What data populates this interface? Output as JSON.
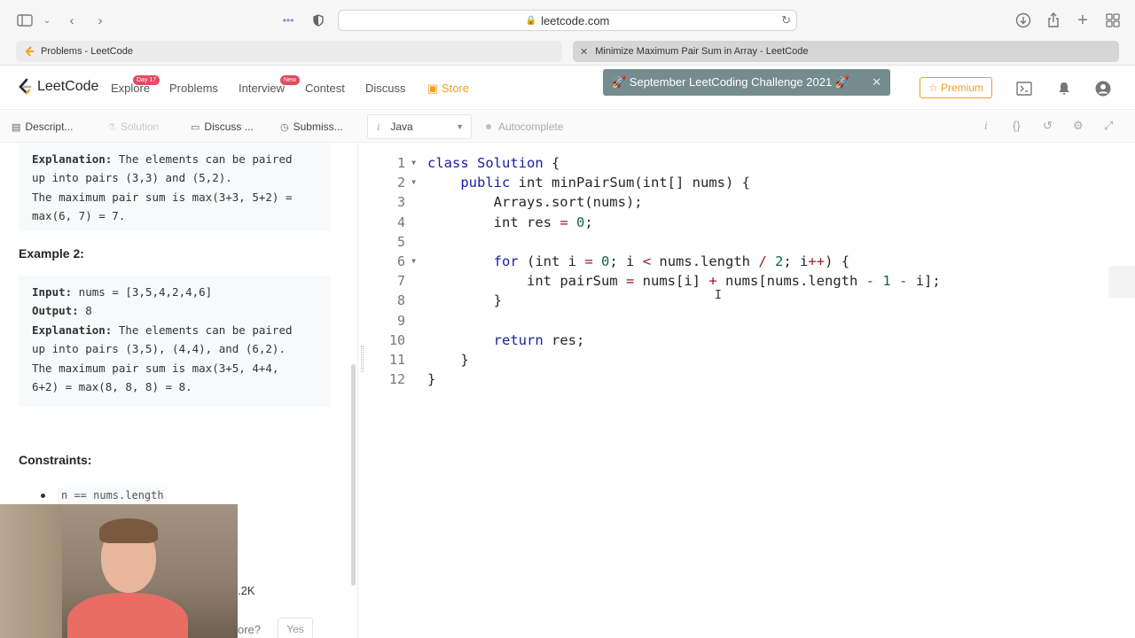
{
  "browser": {
    "url": "leetcode.com",
    "tabs": [
      {
        "title": "Problems - LeetCode"
      },
      {
        "title": "Minimize Maximum Pair Sum in Array - LeetCode"
      }
    ]
  },
  "nav": {
    "logo": "LeetCode",
    "items": [
      "Explore",
      "Problems",
      "Interview",
      "Contest",
      "Discuss",
      "Store"
    ],
    "explore_badge": "Day 17",
    "interview_badge": "New",
    "challenge": "🚀 September LeetCoding Challenge 2021 🚀",
    "premium": "☆ Premium"
  },
  "subtabs": {
    "description": "Descript...",
    "solution": "Solution",
    "discuss": "Discuss ...",
    "submissions": "Submiss..."
  },
  "editor_toolbar": {
    "language": "Java",
    "autocomplete": "Autocomplete"
  },
  "description": {
    "example1_explanation": [
      "Explanation: The elements can be paired",
      "up into pairs (3,3) and (5,2).",
      "The maximum pair sum is max(3+3, 5+2) =",
      "max(6, 7) = 7."
    ],
    "example2_title": "Example 2:",
    "example2_lines": [
      "Input: nums = [3,5,4,2,4,6]",
      "Output: 8",
      "Explanation: The elements can be paired",
      "up into pairs (3,5), (4,4), and (6,2).",
      "The maximum pair sum is max(3+5, 4+4,",
      "6+2) = max(8, 8, 8) = 8."
    ],
    "constraints_title": "Constraints:",
    "constraint1": "n == nums.length",
    "likes_partial": ".2K",
    "more_partial": "ore?",
    "yes_label": "Yes"
  },
  "code_lines": [
    "1",
    "2",
    "3",
    "4",
    "5",
    "6",
    "7",
    "8",
    "9",
    "10",
    "11",
    "12"
  ]
}
